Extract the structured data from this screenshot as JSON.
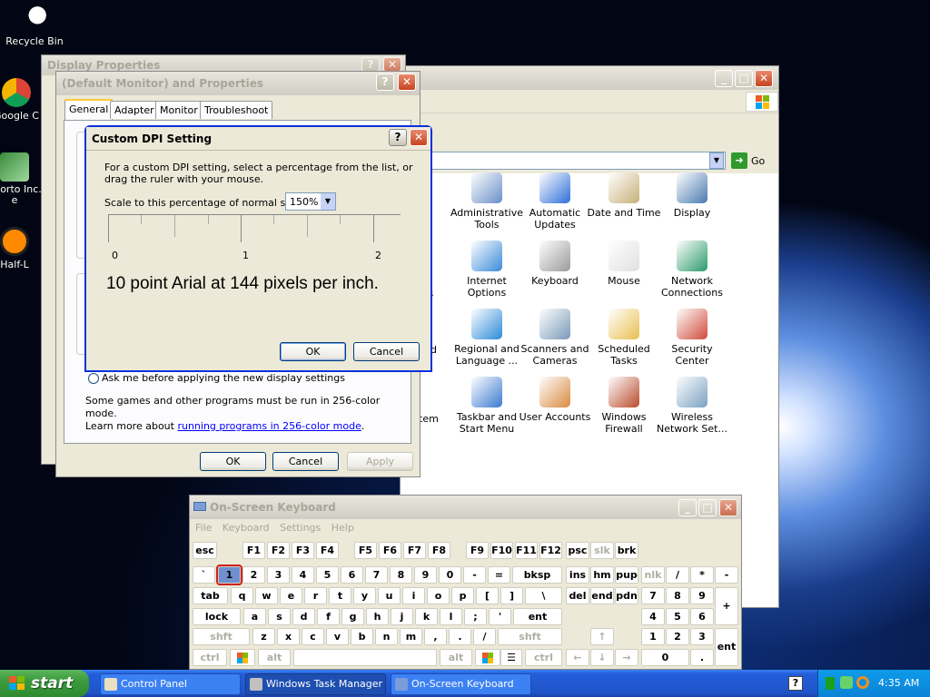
{
  "desktop": {
    "icons": [
      {
        "label": "Recycle Bin",
        "icon": "recycle-bin-icon"
      },
      {
        "label": "Google C",
        "icon": "chrome-icon"
      },
      {
        "label": "Shorto Inc. e",
        "icon": "shortcut-icon"
      },
      {
        "label": "Half-L",
        "icon": "half-life-icon"
      }
    ]
  },
  "display_properties_bg": {
    "title": "Display Properties"
  },
  "monitor_props": {
    "title": "(Default Monitor) and  Properties",
    "tabs": [
      "General",
      "Adapter",
      "Monitor",
      "Troubleshoot"
    ],
    "radio_label": "Ask me before applying the new display settings",
    "note_line1": "Some games and other programs must be run in 256-color mode.",
    "note_line2_pre": "Learn more about ",
    "note_link": "running programs in 256-color mode",
    "note_line2_post": ".",
    "ok": "OK",
    "cancel": "Cancel",
    "apply": "Apply"
  },
  "dpi_dialog": {
    "title": "Custom DPI Setting",
    "instructions_1": "For a custom DPI setting, select a percentage from the list, or",
    "instructions_2": "drag the ruler with your mouse.",
    "scale_label": "Scale to this percentage of normal size:",
    "scale_value": "150%",
    "ruler_labels": [
      "0",
      "1",
      "2"
    ],
    "sample_text": "10 point Arial at 144 pixels per inch.",
    "ok": "OK",
    "cancel": "Cancel"
  },
  "control_panel": {
    "address_go": "Go",
    "partial_labels": [
      "rs",
      "nd",
      "tem"
    ],
    "items": [
      {
        "label1": "Administrative",
        "label2": "Tools",
        "icon": "administrative-tools-icon"
      },
      {
        "label1": "Automatic",
        "label2": "Updates",
        "icon": "automatic-updates-icon"
      },
      {
        "label1": "Date and Time",
        "label2": "",
        "icon": "date-time-icon"
      },
      {
        "label1": "Display",
        "label2": "",
        "icon": "display-icon"
      },
      {
        "label1": "Internet",
        "label2": "Options",
        "icon": "internet-options-icon"
      },
      {
        "label1": "Keyboard",
        "label2": "",
        "icon": "keyboard-icon"
      },
      {
        "label1": "Mouse",
        "label2": "",
        "icon": "mouse-icon"
      },
      {
        "label1": "Network",
        "label2": "Connections",
        "icon": "network-connections-icon"
      },
      {
        "label1": "Regional and",
        "label2": "Language ...",
        "icon": "regional-language-icon"
      },
      {
        "label1": "Scanners and",
        "label2": "Cameras",
        "icon": "scanners-cameras-icon"
      },
      {
        "label1": "Scheduled",
        "label2": "Tasks",
        "icon": "scheduled-tasks-icon"
      },
      {
        "label1": "Security",
        "label2": "Center",
        "icon": "security-center-icon"
      },
      {
        "label1": "Taskbar and",
        "label2": "Start Menu",
        "icon": "taskbar-start-menu-icon"
      },
      {
        "label1": "User Accounts",
        "label2": "",
        "icon": "user-accounts-icon"
      },
      {
        "label1": "Windows",
        "label2": "Firewall",
        "icon": "windows-firewall-icon"
      },
      {
        "label1": "Wireless",
        "label2": "Network Set...",
        "icon": "wireless-network-icon"
      }
    ]
  },
  "osk": {
    "title": "On-Screen Keyboard",
    "menu": [
      "File",
      "Keyboard",
      "Settings",
      "Help"
    ],
    "keys": {
      "esc": "esc",
      "f1": "F1",
      "f2": "F2",
      "f3": "F3",
      "f4": "F4",
      "f5": "F5",
      "f6": "F6",
      "f7": "F7",
      "f8": "F8",
      "f9": "F9",
      "f10": "F10",
      "f11": "F11",
      "f12": "F12",
      "psc": "psc",
      "slk": "slk",
      "brk": "brk",
      "grave": "`",
      "k1": "1",
      "k2": "2",
      "k3": "3",
      "k4": "4",
      "k5": "5",
      "k6": "6",
      "k7": "7",
      "k8": "8",
      "k9": "9",
      "k0": "0",
      "minus": "-",
      "equals": "=",
      "bksp": "bksp",
      "ins": "ins",
      "hm": "hm",
      "pup": "pup",
      "nlk": "nlk",
      "ndiv": "/",
      "nmul": "*",
      "nsub": "-",
      "tab": "tab",
      "q": "q",
      "w": "w",
      "e": "e",
      "r": "r",
      "t": "t",
      "y": "y",
      "u": "u",
      "i": "i",
      "o": "o",
      "p": "p",
      "lbr": "[",
      "rbr": "]",
      "bsl": "\\",
      "del": "del",
      "end": "end",
      "pdn": "pdn",
      "n7": "7",
      "n8": "8",
      "n9": "9",
      "nadd": "+",
      "lock": "lock",
      "a": "a",
      "s": "s",
      "d": "d",
      "f": "f",
      "g": "g",
      "h": "h",
      "j": "j",
      "k": "k",
      "l": "l",
      "semi": ";",
      "quote": "'",
      "ent": "ent",
      "n4": "4",
      "n5": "5",
      "n6": "6",
      "lshift": "shft",
      "z": "z",
      "x": "x",
      "c": "c",
      "v": "v",
      "b": "b",
      "n": "n",
      "m": "m",
      "comma": ",",
      "period": ".",
      "slash": "/",
      "rshift": "shft",
      "up": "↑",
      "n1": "1",
      "n2": "2",
      "n3": "3",
      "nent": "ent",
      "lctrl": "ctrl",
      "lalt": "alt",
      "ralt": "alt",
      "rctrl": "ctrl",
      "left": "←",
      "down": "↓",
      "right": "→",
      "n0": "0",
      "ndot": "."
    }
  },
  "taskbar": {
    "start": "start",
    "tasks": [
      "Control Panel",
      "Windows Task Manager",
      "On-Screen Keyboard"
    ],
    "clock": "4:35 AM"
  }
}
